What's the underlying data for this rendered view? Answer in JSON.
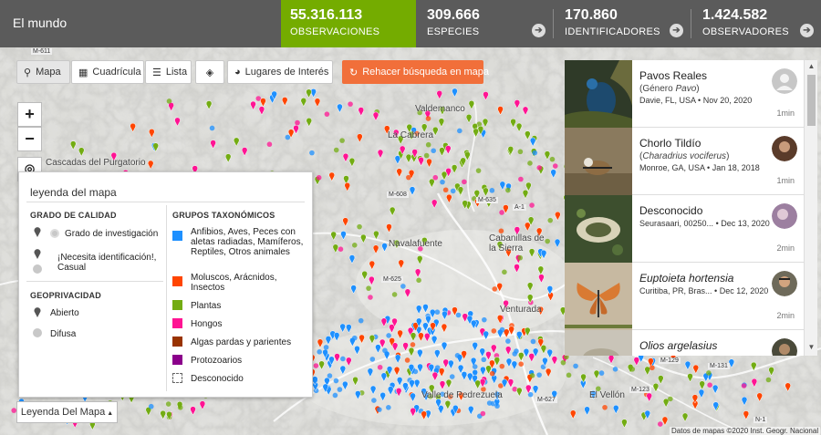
{
  "header": {
    "place": "El mundo",
    "stats": [
      {
        "value": "55.316.113",
        "label": "OBSERVACIONES"
      },
      {
        "value": "309.666",
        "label": "ESPECIES"
      },
      {
        "value": "170.860",
        "label": "IDENTIFICADORES"
      },
      {
        "value": "1.424.582",
        "label": "OBSERVADORES"
      }
    ]
  },
  "toolbar": {
    "map": "Mapa",
    "grid": "Cuadrícula",
    "list": "Lista",
    "places": "Lugares de Interés",
    "redo": "Rehacer búsqueda en mapa"
  },
  "zoom": {
    "in": "+",
    "out": "−"
  },
  "map_labels": [
    "Cascadas del Purgatorio",
    "Valdemanco",
    "La Cabrera",
    "Navalafuente",
    "Cabanillas de la Sierra",
    "Venturada",
    "Valle de Pedrezuela",
    "El Vellón",
    "M-611",
    "M-635",
    "M-625",
    "M-608",
    "A-1",
    "M-627",
    "M-123",
    "M-129",
    "M-131",
    "N-1"
  ],
  "legend": {
    "title": "leyenda del mapa",
    "quality_heading": "GRADO DE CALIDAD",
    "quality": [
      "Grado de investigación",
      "¡Necesita identificación!, Casual"
    ],
    "geo_heading": "GEOPRIVACIDAD",
    "geo": [
      "Abierto",
      "Difusa"
    ],
    "taxa_heading": "GRUPOS TAXONÓMICOS",
    "taxa": [
      {
        "label": "Anfibios, Aves, Peces con aletas radiadas, Mamíferos, Reptiles, Otros animales",
        "color": "#1e90ff"
      },
      {
        "label": "Moluscos, Arácnidos, Insectos",
        "color": "#ff4500"
      },
      {
        "label": "Plantas",
        "color": "#73ac13"
      },
      {
        "label": "Hongos",
        "color": "#ff1493"
      },
      {
        "label": "Algas pardas y parientes",
        "color": "#993300"
      },
      {
        "label": "Protozoarios",
        "color": "#8b008b"
      },
      {
        "label": "Desconocido",
        "color": "#ffffff"
      }
    ],
    "button": "Leyenda Del Mapa"
  },
  "observations": [
    {
      "name": "Pavos Reales",
      "sci_prefix": "(Género ",
      "sci": "Pavo",
      "sci_suffix": ")",
      "place": "Davie, FL, USA",
      "date": "Nov 20, 2020",
      "ago": "1min"
    },
    {
      "name": "Chorlo Tildío",
      "sci_prefix": "(",
      "sci": "Charadrius vociferus",
      "sci_suffix": ")",
      "place": "Monroe, GA, USA",
      "date": "Jan 18, 2018",
      "ago": "1min"
    },
    {
      "name": "Desconocido",
      "sci_prefix": "",
      "sci": "",
      "sci_suffix": "",
      "place": "Seurasaari, 00250...",
      "date": "Dec 13, 2020",
      "ago": "2min"
    },
    {
      "name": "Euptoieta hortensia",
      "sci_prefix": "",
      "sci": "",
      "sci_suffix": "",
      "place": "Curitiba, PR, Bras...",
      "date": "Dec 12, 2020",
      "ago": "2min"
    },
    {
      "name": "Olios argelasius",
      "sci_prefix": "",
      "sci": "",
      "sci_suffix": "",
      "place": "",
      "date": "",
      "ago": ""
    }
  ],
  "bullet": "•",
  "arrow_glyph": "➔",
  "credit": "Datos de mapas ©2020 Inst. Geogr. Nacional"
}
